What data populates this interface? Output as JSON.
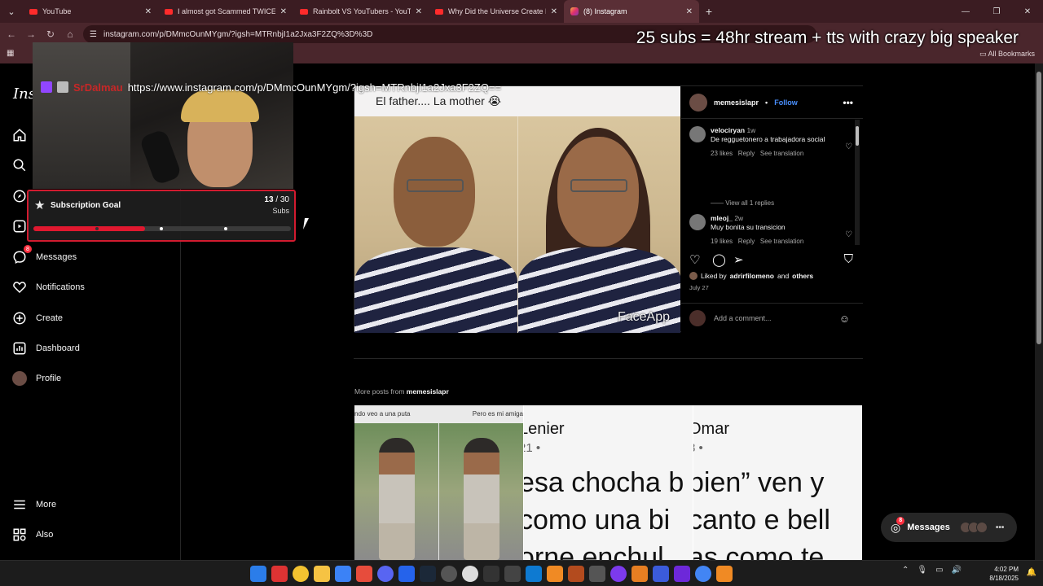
{
  "browser": {
    "tabs": [
      {
        "title": "YouTube",
        "favicon": "youtube-icon",
        "active": false
      },
      {
        "title": "I almost got Scammed TWICE!",
        "favicon": "youtube-icon",
        "active": false
      },
      {
        "title": "Rainbolt VS YouTubers - YouTube",
        "favicon": "youtube-icon",
        "active": false
      },
      {
        "title": "Why Did the Universe Create Li",
        "favicon": "youtube-icon",
        "active": false
      },
      {
        "title": "(8) Instagram",
        "favicon": "instagram-icon",
        "active": true
      }
    ],
    "url": "instagram.com/p/DMmcOunMYgm/?igsh=MTRnbjI1a2Jxa3F2ZQ%3D%3D",
    "all_bookmarks_label": "All Bookmarks"
  },
  "overlay": {
    "headline": "25 subs = 48hr stream + tts with crazy big speaker",
    "streamer_name": "SrDalmau",
    "streamer_url": "https://www.instagram.com/p/DMmcOunMYgm/?igsh=MTRnbjI1a2Jxa3F2ZQ==",
    "sub_goal": {
      "title": "Subscription Goal",
      "current": "13",
      "total": "/ 30",
      "unit": "Subs",
      "progress": 0.433
    }
  },
  "sidebar": {
    "logo": "Inst",
    "items": [
      {
        "id": "home",
        "label": "",
        "icon": "home-icon"
      },
      {
        "id": "search",
        "label": "",
        "icon": "search-icon"
      },
      {
        "id": "explore",
        "label": "",
        "icon": "compass-icon"
      },
      {
        "id": "reels",
        "label": "",
        "icon": "reels-icon"
      },
      {
        "id": "messages",
        "label": "Messages",
        "icon": "messenger-icon",
        "badge": "8"
      },
      {
        "id": "notifications",
        "label": "Notifications",
        "icon": "heart-icon"
      },
      {
        "id": "create",
        "label": "Create",
        "icon": "plus-square-icon"
      },
      {
        "id": "dashboard",
        "label": "Dashboard",
        "icon": "chart-icon"
      },
      {
        "id": "profile",
        "label": "Profile",
        "icon": "avatar"
      }
    ],
    "more_label": "More",
    "also_label": "Also"
  },
  "post": {
    "caption": "El father.... La mother 😭",
    "watermark": "FaceApp",
    "author": "memesislapr",
    "follow_label": "Follow",
    "separator": "•",
    "comments": [
      {
        "user": "velociryan",
        "age": "1w",
        "text": "De regguetonero a trabajadora social",
        "likes": "23 likes",
        "reply": "Reply",
        "translate": "See translation"
      },
      {
        "user": "mleoj_",
        "age": "2w",
        "text": "Muy bonita su transicion",
        "likes": "19 likes",
        "reply": "Reply",
        "translate": "See translation"
      }
    ],
    "view_replies": "View all 1 replies",
    "liked_by_prefix": "Liked by",
    "liked_by_user": "adrirfilomeno",
    "liked_by_and": "and",
    "liked_by_others": "others",
    "date": "July 27",
    "add_comment_placeholder": "Add a comment..."
  },
  "more_posts": {
    "label_prefix": "More posts from",
    "author": "memesislapr",
    "tiles": [
      {
        "top_left": "ndo veo a una puta",
        "top_right": "Pero es mi amiga"
      },
      {
        "name": "Lenier",
        "sub": "21 •",
        "lines": [
          "esa chocha b",
          "como una bi",
          "orne enchul"
        ]
      },
      {
        "name": "Omar",
        "sub": "8 •",
        "lines": [
          "bien” ven y",
          "canto e bell",
          "as como te"
        ]
      }
    ]
  },
  "messages_pill": {
    "label": "Messages",
    "badge": "8"
  },
  "taskbar": {
    "time": "4:02 PM",
    "date": "8/18/2025"
  },
  "colors": {
    "accent_blue": "#4a90ff",
    "goal_red": "#e0182f",
    "tab_bar": "#3b1c22"
  }
}
